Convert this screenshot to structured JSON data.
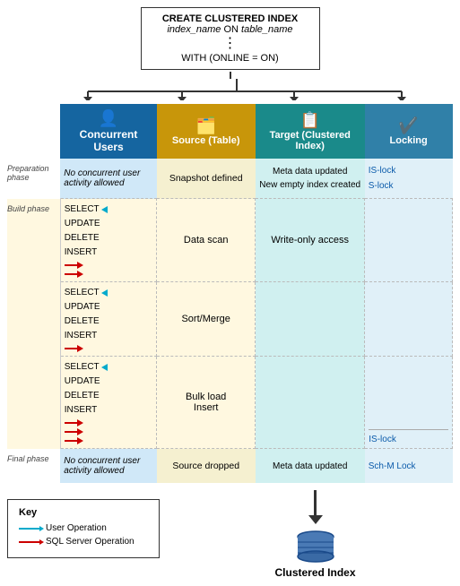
{
  "sql": {
    "line1": "CREATE CLUSTERED INDEX",
    "line2_italic": "index_name",
    "line2_mid": " ON ",
    "line2_italic2": "table_name",
    "dots": "⋮",
    "line3": "WITH (ONLINE = ON)"
  },
  "headers": {
    "concurrent_users": "Concurrent Users",
    "source_table": "Source (Table)",
    "target": "Target (Clustered Index)",
    "locking": "Locking"
  },
  "phases": {
    "preparation": {
      "label": "Preparation phase",
      "concurrent": "No concurrent user activity allowed",
      "source": "Snapshot defined",
      "target_line1": "Meta data updated",
      "target_line2": "New empty index created",
      "locking_line1": "IS-lock",
      "locking_line2": "S-lock"
    },
    "build": {
      "label": "Build phase",
      "subrows": [
        {
          "ops": [
            "SELECT",
            "UPDATE",
            "DELETE",
            "INSERT"
          ],
          "source": "Data scan",
          "target": "Write-only access",
          "locking": ""
        },
        {
          "ops": [
            "SELECT",
            "UPDATE",
            "DELETE",
            "INSERT"
          ],
          "source": "Sort/Merge",
          "target": "",
          "locking": ""
        },
        {
          "ops": [
            "SELECT",
            "UPDATE",
            "DELETE",
            "INSERT"
          ],
          "source": "Bulk load Insert",
          "target": "",
          "locking": "IS-lock"
        }
      ]
    },
    "final": {
      "label": "Final phase",
      "concurrent": "No concurrent user activity allowed",
      "source": "Source dropped",
      "target": "Meta data updated",
      "locking": "Sch-M Lock"
    }
  },
  "key": {
    "title": "Key",
    "user_op": "User Operation",
    "sql_op": "SQL Server Operation"
  },
  "bottom_label": "Clustered Index"
}
